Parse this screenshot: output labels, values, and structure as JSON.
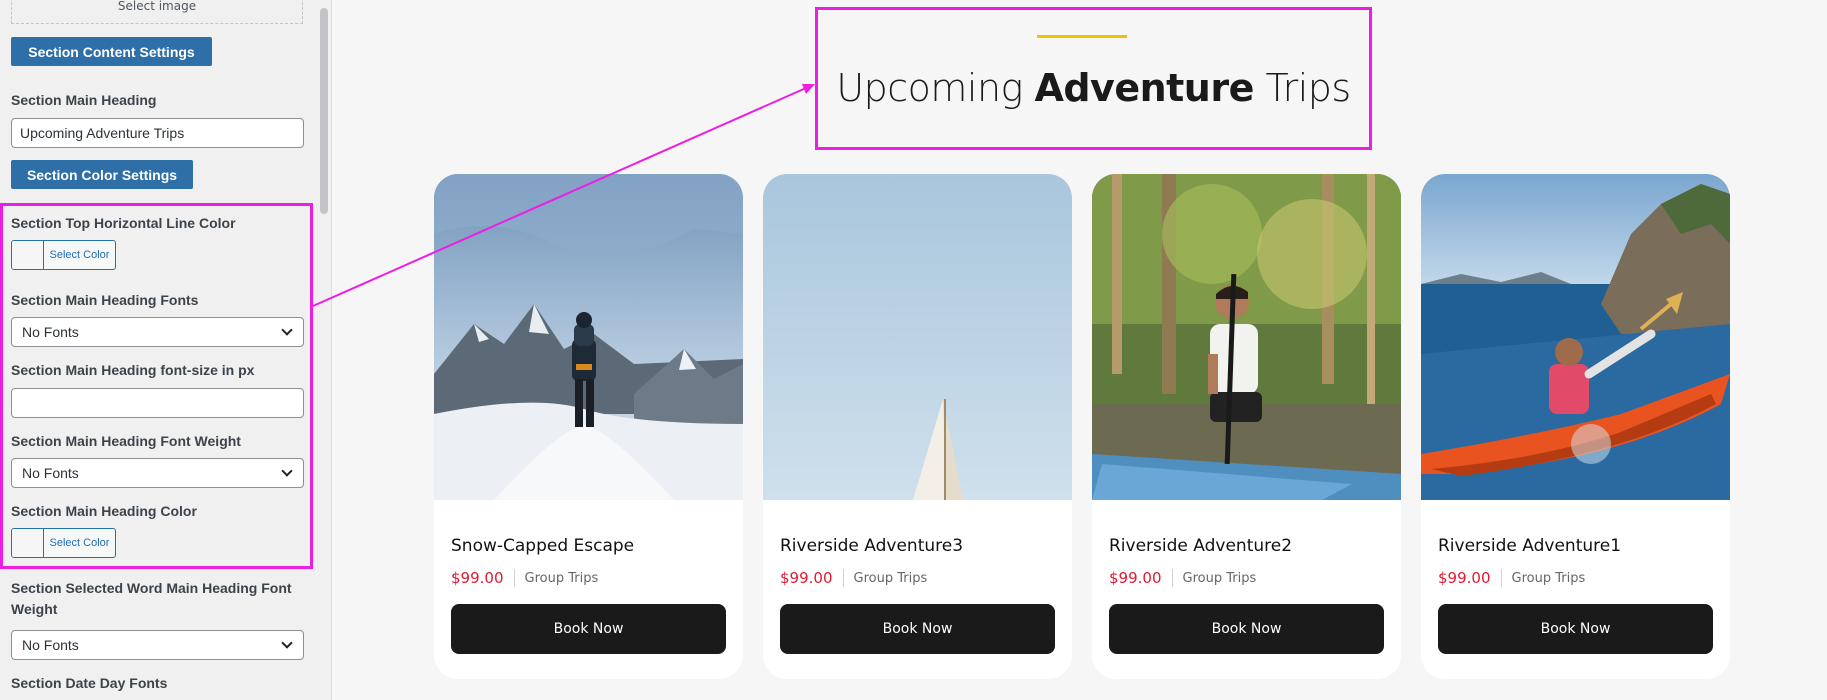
{
  "panel": {
    "select_image_label": "Select image",
    "content_settings_button": "Section Content Settings",
    "main_heading_label": "Section Main Heading",
    "main_heading_value": "Upcoming Adventure Trips",
    "color_settings_button": "Section Color Settings",
    "top_line_color_label": "Section Top Horizontal Line Color",
    "select_color_label": "Select Color",
    "heading_fonts_label": "Section Main Heading Fonts",
    "heading_fonts_value": "No Fonts",
    "heading_font_size_label": "Section Main Heading font-size in px",
    "heading_font_size_value": "",
    "heading_font_weight_label": "Section Main Heading Font Weight",
    "heading_font_weight_value": "No Fonts",
    "heading_color_label": "Section Main Heading Color",
    "selected_word_weight_label": "Section Selected Word Main Heading Font Weight",
    "selected_word_weight_value": "No Fonts",
    "date_day_fonts_label": "Section Date Day Fonts"
  },
  "preview": {
    "heading_prefix": "Upcoming ",
    "heading_bold": "Adventure",
    "heading_suffix": " Trips",
    "cards": [
      {
        "title": "Snow-Capped Escape",
        "price": "$99.00",
        "category": "Group Trips",
        "button": "Book Now",
        "image": "mountain-climber"
      },
      {
        "title": "Riverside Adventure3",
        "price": "$99.00",
        "category": "Group Trips",
        "button": "Book Now",
        "image": "sailboat-sky"
      },
      {
        "title": "Riverside Adventure2",
        "price": "$99.00",
        "category": "Group Trips",
        "button": "Book Now",
        "image": "canoe-paddler"
      },
      {
        "title": "Riverside Adventure1",
        "price": "$99.00",
        "category": "Group Trips",
        "button": "Book Now",
        "image": "kayak-sea"
      }
    ]
  },
  "colors": {
    "annotation": "#ec1ee3",
    "accent_line": "#f2c200",
    "price": "#e3182f",
    "button_bg": "#1a1a1a",
    "panel_button": "#2f6fa8"
  }
}
